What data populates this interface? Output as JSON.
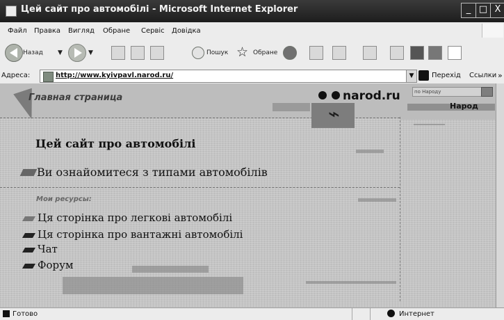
{
  "window": {
    "title": "Цей сайт про автомобілі - Microsoft Internet Explorer",
    "buttons": [
      "_",
      "□",
      "X"
    ]
  },
  "menu": {
    "items": [
      "Файл",
      "Правка",
      "Вигляд",
      "Обране",
      "Сервіс",
      "Довідка"
    ]
  },
  "toolbar": {
    "back": "Назад",
    "search": "Пошук",
    "favorites": "Обране"
  },
  "address": {
    "label": "Адреса:",
    "url": "http://www.kyivpavl.narod.ru/",
    "go": "Перехід",
    "links": "Ссылки"
  },
  "page": {
    "home": "Главная страница",
    "logo": "narod.ru",
    "search_placeholder": "по Народу",
    "side_menu": "Народ"
  },
  "content": {
    "title": "Цей сайт про автомобілі",
    "intro": "Ви ознайомитеся з типами автомобілів",
    "resources_label": "Мои ресурсы:",
    "links": [
      "Ця сторінка про легкові автомобілі",
      "Ця сторінка про вантажні автомобілі",
      "Чат",
      "Форум"
    ]
  },
  "status": {
    "text": "Готово",
    "zone": "Интернет"
  }
}
